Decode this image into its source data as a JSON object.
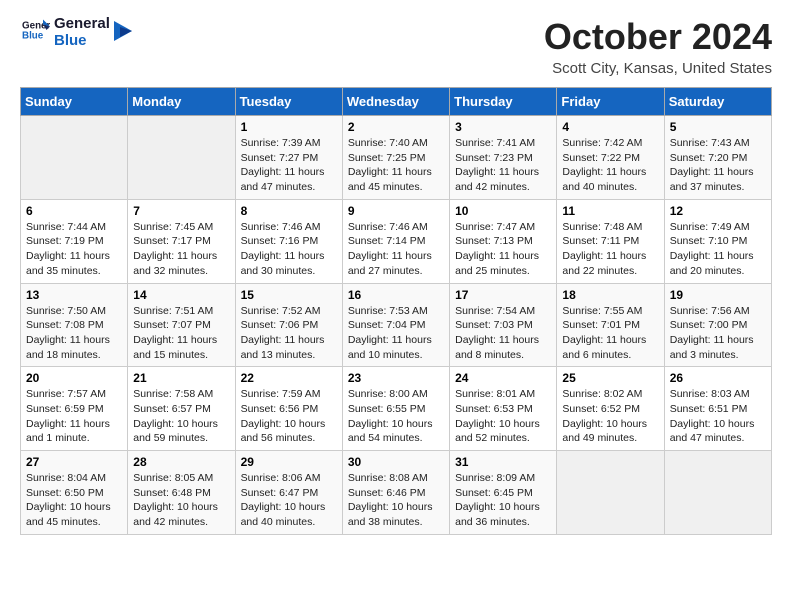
{
  "header": {
    "logo_line1": "General",
    "logo_line2": "Blue",
    "month_title": "October 2024",
    "location": "Scott City, Kansas, United States"
  },
  "days_of_week": [
    "Sunday",
    "Monday",
    "Tuesday",
    "Wednesday",
    "Thursday",
    "Friday",
    "Saturday"
  ],
  "weeks": [
    [
      {
        "day": "",
        "info": ""
      },
      {
        "day": "",
        "info": ""
      },
      {
        "day": "1",
        "info": "Sunrise: 7:39 AM\nSunset: 7:27 PM\nDaylight: 11 hours and 47 minutes."
      },
      {
        "day": "2",
        "info": "Sunrise: 7:40 AM\nSunset: 7:25 PM\nDaylight: 11 hours and 45 minutes."
      },
      {
        "day": "3",
        "info": "Sunrise: 7:41 AM\nSunset: 7:23 PM\nDaylight: 11 hours and 42 minutes."
      },
      {
        "day": "4",
        "info": "Sunrise: 7:42 AM\nSunset: 7:22 PM\nDaylight: 11 hours and 40 minutes."
      },
      {
        "day": "5",
        "info": "Sunrise: 7:43 AM\nSunset: 7:20 PM\nDaylight: 11 hours and 37 minutes."
      }
    ],
    [
      {
        "day": "6",
        "info": "Sunrise: 7:44 AM\nSunset: 7:19 PM\nDaylight: 11 hours and 35 minutes."
      },
      {
        "day": "7",
        "info": "Sunrise: 7:45 AM\nSunset: 7:17 PM\nDaylight: 11 hours and 32 minutes."
      },
      {
        "day": "8",
        "info": "Sunrise: 7:46 AM\nSunset: 7:16 PM\nDaylight: 11 hours and 30 minutes."
      },
      {
        "day": "9",
        "info": "Sunrise: 7:46 AM\nSunset: 7:14 PM\nDaylight: 11 hours and 27 minutes."
      },
      {
        "day": "10",
        "info": "Sunrise: 7:47 AM\nSunset: 7:13 PM\nDaylight: 11 hours and 25 minutes."
      },
      {
        "day": "11",
        "info": "Sunrise: 7:48 AM\nSunset: 7:11 PM\nDaylight: 11 hours and 22 minutes."
      },
      {
        "day": "12",
        "info": "Sunrise: 7:49 AM\nSunset: 7:10 PM\nDaylight: 11 hours and 20 minutes."
      }
    ],
    [
      {
        "day": "13",
        "info": "Sunrise: 7:50 AM\nSunset: 7:08 PM\nDaylight: 11 hours and 18 minutes."
      },
      {
        "day": "14",
        "info": "Sunrise: 7:51 AM\nSunset: 7:07 PM\nDaylight: 11 hours and 15 minutes."
      },
      {
        "day": "15",
        "info": "Sunrise: 7:52 AM\nSunset: 7:06 PM\nDaylight: 11 hours and 13 minutes."
      },
      {
        "day": "16",
        "info": "Sunrise: 7:53 AM\nSunset: 7:04 PM\nDaylight: 11 hours and 10 minutes."
      },
      {
        "day": "17",
        "info": "Sunrise: 7:54 AM\nSunset: 7:03 PM\nDaylight: 11 hours and 8 minutes."
      },
      {
        "day": "18",
        "info": "Sunrise: 7:55 AM\nSunset: 7:01 PM\nDaylight: 11 hours and 6 minutes."
      },
      {
        "day": "19",
        "info": "Sunrise: 7:56 AM\nSunset: 7:00 PM\nDaylight: 11 hours and 3 minutes."
      }
    ],
    [
      {
        "day": "20",
        "info": "Sunrise: 7:57 AM\nSunset: 6:59 PM\nDaylight: 11 hours and 1 minute."
      },
      {
        "day": "21",
        "info": "Sunrise: 7:58 AM\nSunset: 6:57 PM\nDaylight: 10 hours and 59 minutes."
      },
      {
        "day": "22",
        "info": "Sunrise: 7:59 AM\nSunset: 6:56 PM\nDaylight: 10 hours and 56 minutes."
      },
      {
        "day": "23",
        "info": "Sunrise: 8:00 AM\nSunset: 6:55 PM\nDaylight: 10 hours and 54 minutes."
      },
      {
        "day": "24",
        "info": "Sunrise: 8:01 AM\nSunset: 6:53 PM\nDaylight: 10 hours and 52 minutes."
      },
      {
        "day": "25",
        "info": "Sunrise: 8:02 AM\nSunset: 6:52 PM\nDaylight: 10 hours and 49 minutes."
      },
      {
        "day": "26",
        "info": "Sunrise: 8:03 AM\nSunset: 6:51 PM\nDaylight: 10 hours and 47 minutes."
      }
    ],
    [
      {
        "day": "27",
        "info": "Sunrise: 8:04 AM\nSunset: 6:50 PM\nDaylight: 10 hours and 45 minutes."
      },
      {
        "day": "28",
        "info": "Sunrise: 8:05 AM\nSunset: 6:48 PM\nDaylight: 10 hours and 42 minutes."
      },
      {
        "day": "29",
        "info": "Sunrise: 8:06 AM\nSunset: 6:47 PM\nDaylight: 10 hours and 40 minutes."
      },
      {
        "day": "30",
        "info": "Sunrise: 8:08 AM\nSunset: 6:46 PM\nDaylight: 10 hours and 38 minutes."
      },
      {
        "day": "31",
        "info": "Sunrise: 8:09 AM\nSunset: 6:45 PM\nDaylight: 10 hours and 36 minutes."
      },
      {
        "day": "",
        "info": ""
      },
      {
        "day": "",
        "info": ""
      }
    ]
  ]
}
